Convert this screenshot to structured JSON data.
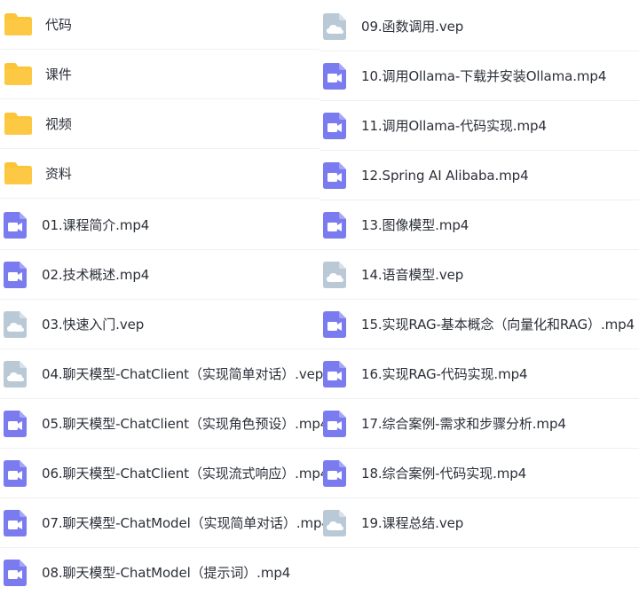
{
  "left_items": [
    {
      "type": "folder",
      "icon": "folder-icon",
      "label": "代码"
    },
    {
      "type": "folder",
      "icon": "folder-icon",
      "label": "课件"
    },
    {
      "type": "folder",
      "icon": "folder-icon",
      "label": "视频"
    },
    {
      "type": "folder",
      "icon": "folder-icon",
      "label": "资料"
    },
    {
      "type": "video",
      "icon": "video-file-icon",
      "label": "01.课程简介.mp4"
    },
    {
      "type": "video",
      "icon": "video-file-icon",
      "label": "02.技术概述.mp4"
    },
    {
      "type": "cloud",
      "icon": "cloud-file-icon",
      "label": "03.快速入门.vep"
    },
    {
      "type": "cloud",
      "icon": "cloud-file-icon",
      "label": "04.聊天模型-ChatClient（实现简单对话）.vep"
    },
    {
      "type": "video",
      "icon": "video-file-icon",
      "label": "05.聊天模型-ChatClient（实现角色预设）.mp4"
    },
    {
      "type": "video",
      "icon": "video-file-icon",
      "label": "06.聊天模型-ChatClient（实现流式响应）.mp4"
    },
    {
      "type": "video",
      "icon": "video-file-icon",
      "label": "07.聊天模型-ChatModel（实现简单对话）.mp4"
    },
    {
      "type": "video",
      "icon": "video-file-icon",
      "label": "08.聊天模型-ChatModel（提示词）.mp4"
    }
  ],
  "right_items": [
    {
      "type": "cloud",
      "icon": "cloud-file-icon",
      "label": "09.函数调用.vep"
    },
    {
      "type": "video",
      "icon": "video-file-icon",
      "label": "10.调用Ollama-下载并安装Ollama.mp4"
    },
    {
      "type": "video",
      "icon": "video-file-icon",
      "label": "11.调用Ollama-代码实现.mp4"
    },
    {
      "type": "video",
      "icon": "video-file-icon",
      "label": "12.Spring AI Alibaba.mp4"
    },
    {
      "type": "video",
      "icon": "video-file-icon",
      "label": "13.图像模型.mp4"
    },
    {
      "type": "cloud",
      "icon": "cloud-file-icon",
      "label": "14.语音模型.vep"
    },
    {
      "type": "video",
      "icon": "video-file-icon",
      "label": "15.实现RAG-基本概念（向量化和RAG）.mp4"
    },
    {
      "type": "video",
      "icon": "video-file-icon",
      "label": "16.实现RAG-代码实现.mp4"
    },
    {
      "type": "video",
      "icon": "video-file-icon",
      "label": "17.综合案例-需求和步骤分析.mp4"
    },
    {
      "type": "video",
      "icon": "video-file-icon",
      "label": "18.综合案例-代码实现.mp4"
    },
    {
      "type": "cloud",
      "icon": "cloud-file-icon",
      "label": "19.课程总结.vep"
    }
  ],
  "colors": {
    "folder": "#fcc537",
    "video": "#7b7bf0",
    "cloud": "#b9c9d6",
    "text": "#2b2f38"
  }
}
